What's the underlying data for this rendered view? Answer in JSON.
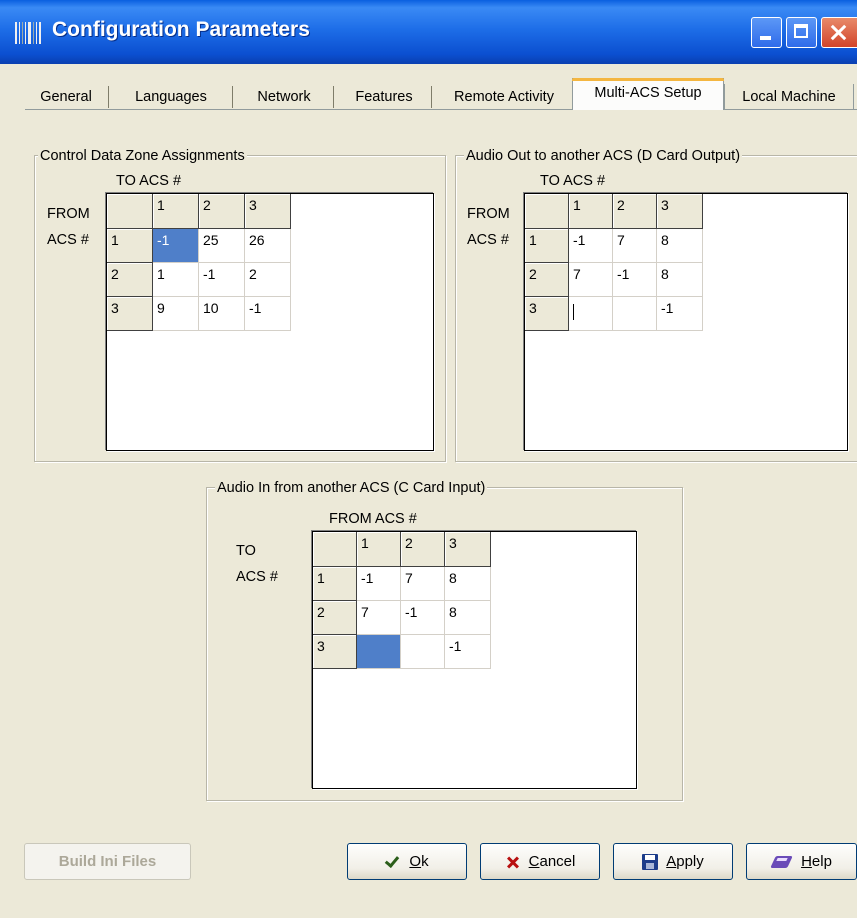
{
  "window": {
    "title": "Configuration Parameters"
  },
  "tabs": [
    {
      "label": "General"
    },
    {
      "label": "Languages"
    },
    {
      "label": "Network"
    },
    {
      "label": "Features"
    },
    {
      "label": "Remote Activity"
    },
    {
      "label": "Multi-ACS Setup",
      "active": true
    },
    {
      "label": "Local Machine"
    }
  ],
  "control_data": {
    "title": "Control Data Zone Assignments",
    "col_label": "TO ACS #",
    "row_label_1": "FROM",
    "row_label_2": "ACS #",
    "col_headers": [
      "1",
      "2",
      "3"
    ],
    "rows": [
      {
        "header": "1",
        "cells": [
          "-1",
          "25",
          "26"
        ]
      },
      {
        "header": "2",
        "cells": [
          "1",
          "-1",
          "2"
        ]
      },
      {
        "header": "3",
        "cells": [
          "9",
          "10",
          "-1"
        ]
      }
    ]
  },
  "audio_out": {
    "title": "Audio Out to another ACS (D Card Output)",
    "col_label": "TO ACS #",
    "row_label_1": "FROM",
    "row_label_2": "ACS #",
    "col_headers": [
      "1",
      "2",
      "3"
    ],
    "rows": [
      {
        "header": "1",
        "cells": [
          "-1",
          "7",
          "8"
        ]
      },
      {
        "header": "2",
        "cells": [
          "7",
          "-1",
          "8"
        ]
      },
      {
        "header": "3",
        "cells": [
          "",
          "",
          "-1"
        ]
      }
    ]
  },
  "audio_in": {
    "title": "Audio In from another ACS (C Card Input)",
    "col_label": "FROM ACS #",
    "row_label_1": "TO",
    "row_label_2": "ACS #",
    "col_headers": [
      "1",
      "2",
      "3"
    ],
    "rows": [
      {
        "header": "1",
        "cells": [
          "-1",
          "7",
          "8"
        ]
      },
      {
        "header": "2",
        "cells": [
          "7",
          "-1",
          "8"
        ]
      },
      {
        "header": "3",
        "cells": [
          "",
          "",
          "-1"
        ]
      }
    ]
  },
  "buttons": {
    "build": "Build Ini Files",
    "ok_pre": "",
    "ok_u": "O",
    "ok_post": "k",
    "cancel_u": "C",
    "cancel_post": "ancel",
    "apply_u": "A",
    "apply_post": "pply",
    "help_u": "H",
    "help_post": "elp"
  },
  "icons": {
    "app": "barcode-app-icon",
    "ok": "checkmark-icon",
    "cancel": "red-x-icon",
    "apply": "floppy-disk-icon",
    "help": "help-book-icon"
  },
  "colors": {
    "titlebar": "#1e6ee8",
    "selection": "#4f7fc9",
    "active_tab_accent": "#f4b640",
    "dialog_bg": "#ece9d8"
  }
}
